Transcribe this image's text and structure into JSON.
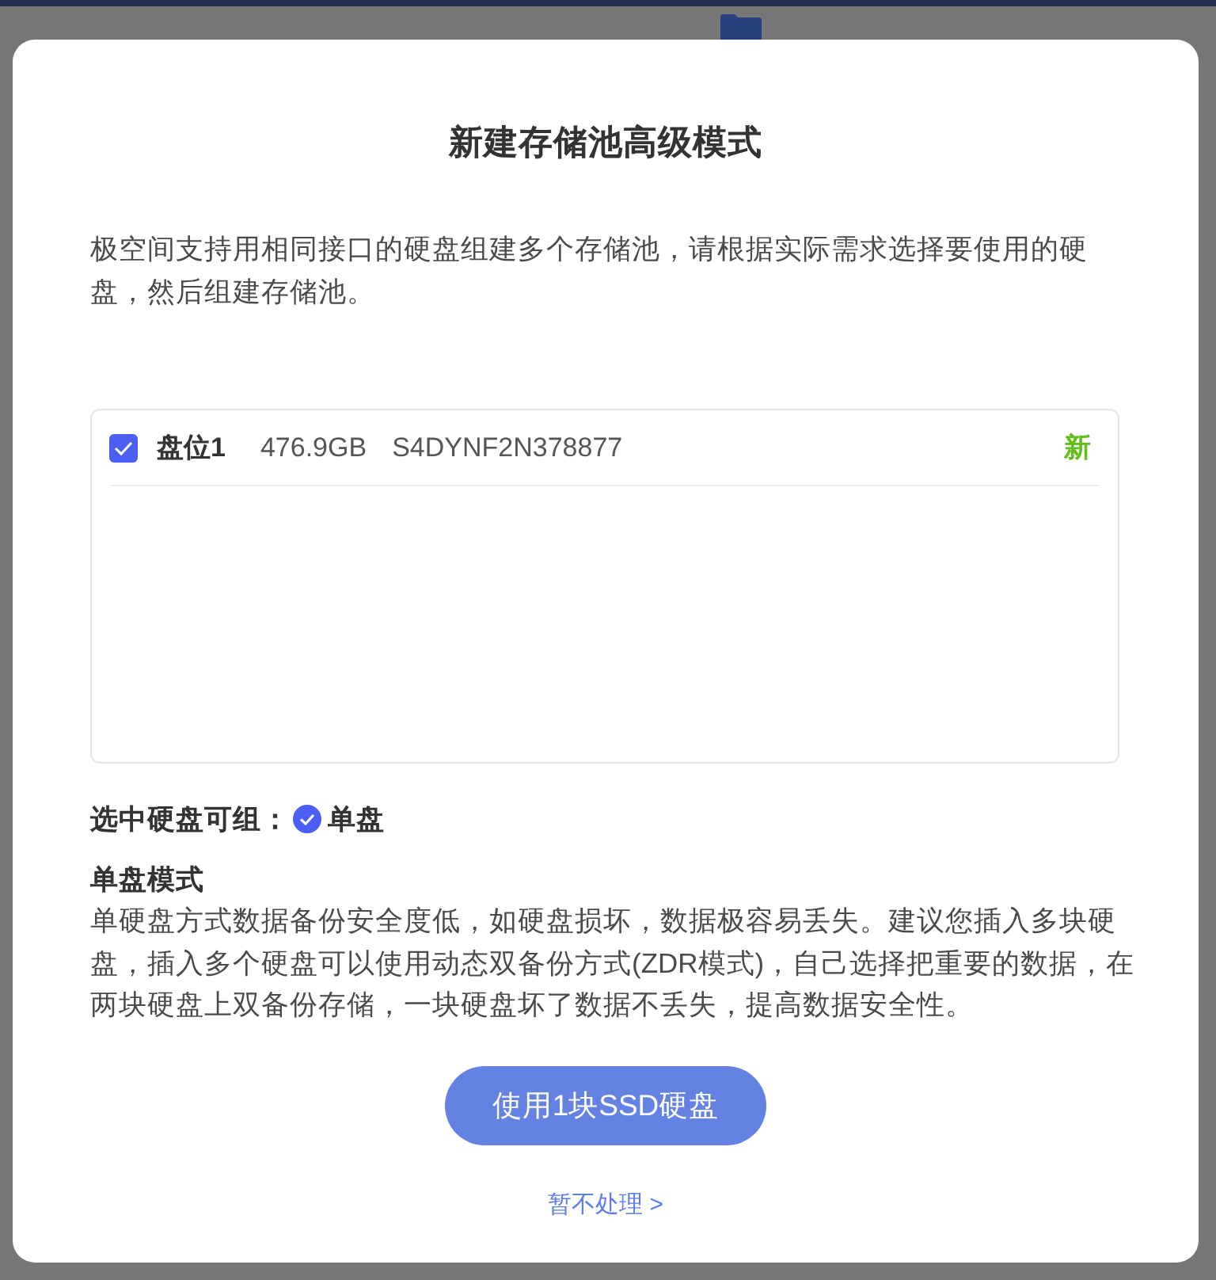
{
  "dialog": {
    "title": "新建存储池高级模式",
    "description": "极空间支持用相同接口的硬盘组建多个存储池，请根据实际需求选择要使用的硬盘，然后组建存储池。"
  },
  "disks": [
    {
      "checked": true,
      "slot": "盘位1",
      "capacity": "476.9GB",
      "serial": "S4DYNF2N378877",
      "badge": "新"
    }
  ],
  "selection": {
    "label": "选中硬盘可组：",
    "options": [
      {
        "label": "单盘",
        "selected": true
      }
    ]
  },
  "mode": {
    "title": "单盘模式",
    "text": "单硬盘方式数据备份安全度低，如硬盘损坏，数据极容易丢失。建议您插入多块硬盘，插入多个硬盘可以使用动态双备份方式(ZDR模式)，自己选择把重要的数据，在两块硬盘上双备份存储，一块硬盘坏了数据不丢失，提高数据安全性。"
  },
  "primary_button": "使用1块SSD硬盘",
  "skip_link": "暂不处理 >"
}
